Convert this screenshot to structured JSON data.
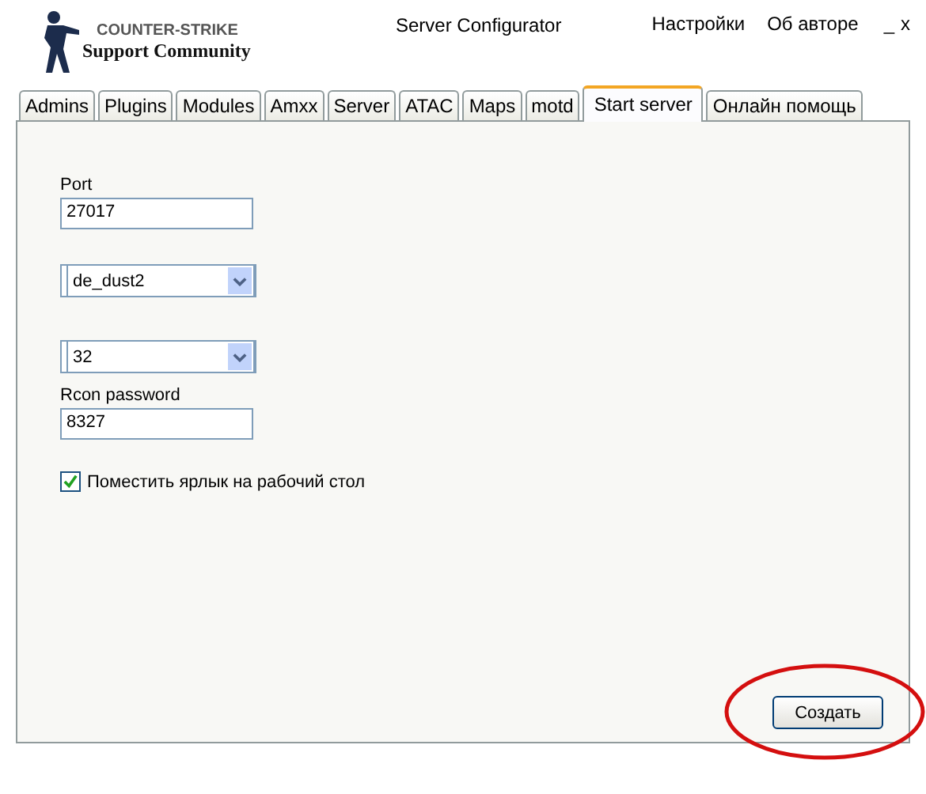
{
  "header": {
    "logo_title": "COUNTER-STRIKE",
    "logo_subtitle": "Support Community",
    "title": "Server Configurator",
    "menu": [
      "Настройки",
      "Об авторе"
    ],
    "window_controls": [
      "_",
      "x"
    ]
  },
  "tabs": [
    {
      "label": "Admins",
      "selected": false
    },
    {
      "label": "Plugins",
      "selected": false
    },
    {
      "label": "Modules",
      "selected": false
    },
    {
      "label": "Amxx",
      "selected": false
    },
    {
      "label": "Server",
      "selected": false
    },
    {
      "label": "ATAC",
      "selected": false
    },
    {
      "label": "Maps",
      "selected": false
    },
    {
      "label": "motd",
      "selected": false
    },
    {
      "label": "Start server",
      "selected": true
    },
    {
      "label": "Онлайн помощь",
      "selected": false
    }
  ],
  "form": [
    {
      "kind": "text",
      "label": "Port",
      "value": "27017"
    },
    {
      "kind": "combo",
      "value": "de_dust2"
    },
    {
      "kind": "combo",
      "value": "32"
    },
    {
      "kind": "text",
      "label": "Rcon password",
      "value": "8327"
    },
    {
      "kind": "checkbox",
      "label": "Поместить ярлык на рабочий стол",
      "checked": true
    }
  ],
  "create_button": {
    "label": "Создать",
    "highlighted": true
  }
}
